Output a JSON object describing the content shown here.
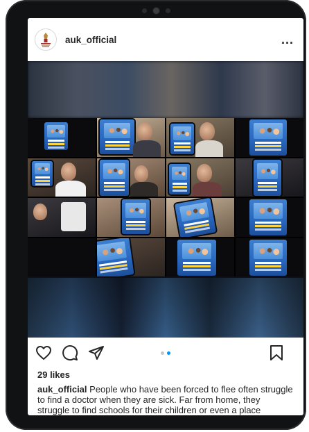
{
  "post": {
    "username": "auk_official",
    "more_label": "...",
    "likes": "29 likes",
    "caption_user": "auk_official",
    "caption_text": "People who have been forced to flee often struggle to find a doctor when they are sick. Far from home, they struggle to find schools for their children or even a place",
    "carousel": {
      "count": 2,
      "active_index": 1
    }
  },
  "icons": {
    "like": "heart-outline-icon",
    "comment": "comment-bubble-icon",
    "share": "paper-plane-icon",
    "save": "bookmark-outline-icon",
    "more": "ellipsis-icon"
  },
  "colors": {
    "text": "#262626",
    "carousel_active": "#0095f6",
    "carousel_inactive": "#c7c7c7",
    "device_frame": "#111214"
  }
}
